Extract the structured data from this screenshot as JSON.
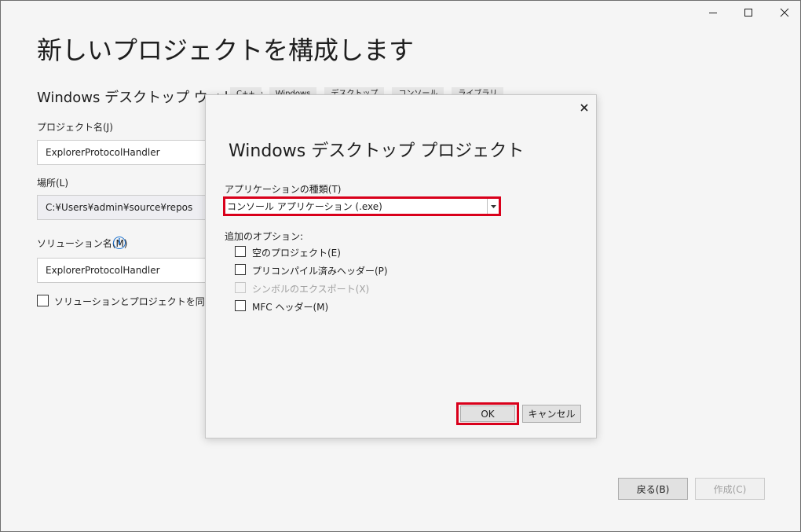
{
  "window": {
    "title": "新しいプロジェクトを構成します",
    "subtitle": "Windows デスクトップ ウィザード",
    "tags": [
      "C++",
      "Windows",
      "デスクトップ",
      "コンソール",
      "ライブラリ"
    ]
  },
  "form": {
    "project_name_label": "プロジェクト名(J)",
    "project_name_value": "ExplorerProtocolHandler",
    "location_label": "場所(L)",
    "location_value": "C:¥Users¥admin¥source¥repos",
    "solution_name_label": "ソリューション名(M)",
    "solution_name_value": "ExplorerProtocolHandler",
    "same_dir_label": "ソリューションとプロジェクトを同じディレクトリに配置する(D)"
  },
  "footer": {
    "back_label": "戻る(B)",
    "create_label": "作成(C)"
  },
  "dialog": {
    "title": "Windows デスクトップ プロジェクト",
    "app_type_label": "アプリケーションの種類(T)",
    "app_type_value": "コンソール アプリケーション (.exe)",
    "options_label": "追加のオプション:",
    "options": [
      {
        "label": "空のプロジェクト(E)",
        "checked": false,
        "enabled": true
      },
      {
        "label": "プリコンパイル済みヘッダー(P)",
        "checked": false,
        "enabled": true
      },
      {
        "label": "シンボルのエクスポート(X)",
        "checked": false,
        "enabled": false
      },
      {
        "label": "MFC ヘッダー(M)",
        "checked": false,
        "enabled": true
      }
    ],
    "ok_label": "OK",
    "cancel_label": "キャンセル"
  },
  "colors": {
    "highlight": "#d9001b",
    "info_icon": "#1e73d0"
  }
}
